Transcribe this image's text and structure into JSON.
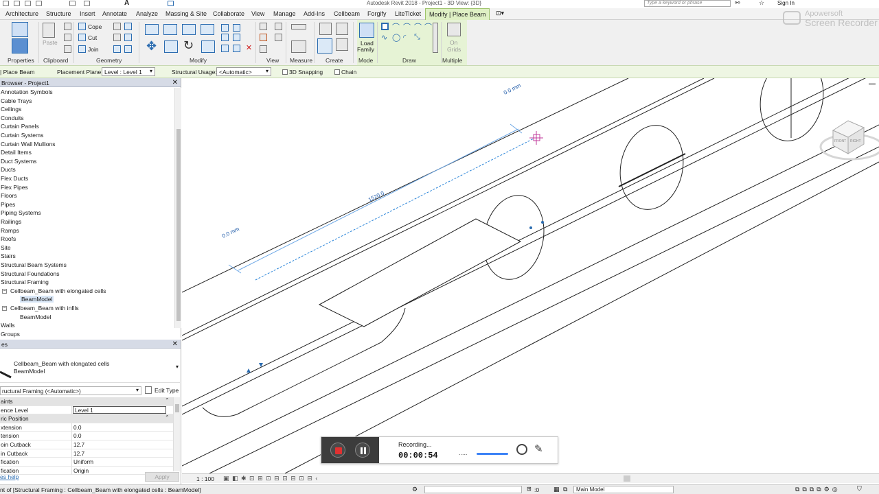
{
  "app": {
    "title": "Autodesk Revit 2018 -  Project1 - 3D View: {3D}",
    "search_placeholder": "Type a keyword or phrase",
    "sign_in": "Sign In",
    "watermark_line1": "Apowersoft",
    "watermark_line2": "Screen Recorder"
  },
  "tabs": [
    "Architecture",
    "Structure",
    "Insert",
    "Annotate",
    "Analyze",
    "Massing & Site",
    "Collaborate",
    "View",
    "Manage",
    "Add-Ins",
    "Cellbeam",
    "Forgify",
    "LiteTicket",
    "Modify | Place Beam"
  ],
  "ribbon": {
    "panels": [
      "Properties",
      "Clipboard",
      "Geometry",
      "Modify",
      "View",
      "Measure",
      "Create",
      "Mode",
      "Draw",
      "Multiple"
    ],
    "paste": "Paste",
    "cope": "Cope",
    "cut": "Cut",
    "join": "Join",
    "load_family": "Load\nFamily",
    "load": "Load",
    "family": "Family",
    "on_grids_1": "On",
    "on_grids_2": "Grids"
  },
  "options_bar": {
    "context": "Place Beam",
    "placement_plane_label": "Placement Plane:",
    "placement_plane_value": "Level : Level 1",
    "structural_usage_label": "Structural Usage:",
    "structural_usage_value": "<Automatic>",
    "snapping": "3D Snapping",
    "chain": "Chain"
  },
  "browser": {
    "title": "Browser - Project1",
    "items": [
      "Annotation Symbols",
      "Cable Trays",
      "Ceilings",
      "Conduits",
      "Curtain Panels",
      "Curtain Systems",
      "Curtain Wall Mullions",
      "Detail Items",
      "Duct Systems",
      "Ducts",
      "Flex Ducts",
      "Flex Pipes",
      "Floors",
      "Pipes",
      "Piping Systems",
      "Railings",
      "Ramps",
      "Roofs",
      "Site",
      "Stairs",
      "Structural Beam Systems",
      "Structural Foundations",
      "Structural Framing"
    ],
    "sub1": "Cellbeam_Beam with elongated cells",
    "sub1_child": "BeamModel",
    "sub2": "Cellbeam_Beam with infils",
    "sub2_child": "BeamModel",
    "after": [
      "Walls",
      "Groups"
    ]
  },
  "properties": {
    "title": "es",
    "type_line1": "Cellbeam_Beam with elongated cells",
    "type_line2": "BeamModel",
    "filter": "ructural Framing (<Automatic>)",
    "edit_type": "Edit Type",
    "rows": [
      {
        "k": "aints",
        "v": "",
        "group": true
      },
      {
        "k": "ence Level",
        "v": "Level 1",
        "group": false,
        "boxed": true
      },
      {
        "k": "ric Position",
        "v": "",
        "group": true
      },
      {
        "k": "xtension",
        "v": "0.0",
        "group": false
      },
      {
        "k": "tension",
        "v": "0.0",
        "group": false
      },
      {
        "k": "oin Cutback",
        "v": "12.7",
        "group": false
      },
      {
        "k": "in Cutback",
        "v": "12.7",
        "group": false
      },
      {
        "k": "fication",
        "v": "Uniform",
        "group": false
      },
      {
        "k": "fication",
        "v": "Origin",
        "group": false
      }
    ],
    "help": "es help",
    "apply": "Apply"
  },
  "viewport": {
    "dim_top": "0.0 mm",
    "dim_left": "0.0 mm",
    "dim_length": "1520.0",
    "viewcube_front": "FRONT",
    "viewcube_right": "RIGHT"
  },
  "viewbar": {
    "scale": "1 : 100"
  },
  "recorder": {
    "status": "Recording...",
    "time": "00:00:54",
    "dots": "....."
  },
  "status": {
    "text": "nt of [Structural Framing : Cellbeam_Beam with elongated cells : BeamModel]",
    "zero": ":0",
    "model": "Main Model"
  },
  "colors": {
    "accent": "#2b6cb0",
    "ribbon_context": "#dff0c4",
    "record": "#e03131"
  }
}
